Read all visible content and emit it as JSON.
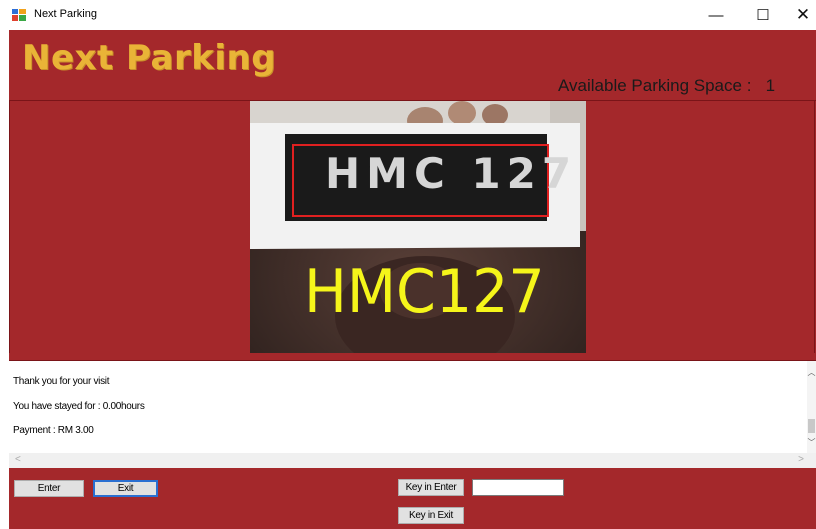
{
  "window": {
    "title": "Next Parking",
    "icon": "app-window-icon",
    "controls": {
      "minimize": "—",
      "maximize": "☐",
      "close": "✕"
    }
  },
  "header": {
    "logo_text": "Next Parking",
    "available_label": "Available Parking Space :",
    "available_value": "1"
  },
  "camera": {
    "plate_text": "HMC 127",
    "detected_text": "HMC127",
    "overlay_color": "#f5f51a",
    "box_color": "#e02020"
  },
  "log": {
    "lines": [
      "Thank you for your visit",
      "You have stayed for : 0.00hours",
      "Payment : RM 3.00"
    ]
  },
  "controls": {
    "enter_label": "Enter",
    "exit_label": "Exit",
    "key_in_enter_label": "Key in Enter",
    "key_in_exit_label": "Key in Exit",
    "plate_input_value": ""
  },
  "colors": {
    "background": "#a4282b",
    "logo": "#e9b437"
  }
}
